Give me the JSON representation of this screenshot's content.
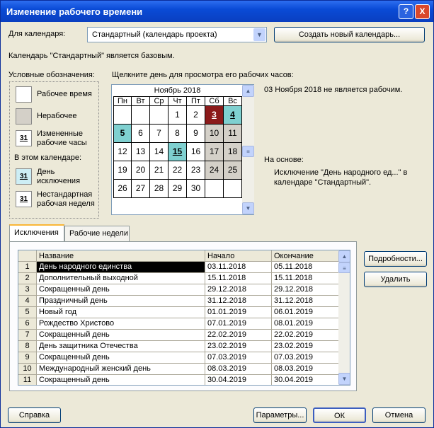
{
  "window": {
    "title": "Изменение рабочего времени",
    "help": "?",
    "close": "X"
  },
  "calendar_label": "Для календаря:",
  "calendar_value": "Стандартный (календарь проекта)",
  "create_button": "Создать новый календарь...",
  "base_note": "Календарь \"Стандартный\" является базовым.",
  "legend": {
    "title": "Условные обозначения:",
    "working": "Рабочее время",
    "nonworking": "Нерабочее",
    "changed": "Измененные рабочие часы",
    "changed_num": "31",
    "in_calendar": "В этом календаре:",
    "exception": "День исключения",
    "exception_num": "31",
    "nonstandard": "Нестандартная рабочая неделя",
    "nonstandard_num": "31"
  },
  "click_hint": "Щелкните день для просмотра его рабочих часов:",
  "calendar": {
    "month": "Ноябрь 2018",
    "weekdays": [
      "Пн",
      "Вт",
      "Ср",
      "Чт",
      "Пт",
      "Сб",
      "Вс"
    ],
    "rows": [
      [
        "",
        "",
        "",
        "1",
        "2",
        "3",
        "4"
      ],
      [
        "5",
        "6",
        "7",
        "8",
        "9",
        "10",
        "11"
      ],
      [
        "12",
        "13",
        "14",
        "15",
        "16",
        "17",
        "18"
      ],
      [
        "19",
        "20",
        "21",
        "22",
        "23",
        "24",
        "25"
      ],
      [
        "26",
        "27",
        "28",
        "29",
        "30",
        "",
        ""
      ]
    ]
  },
  "day_info": "03 Ноября 2018 не является рабочим.",
  "based_on_label": "На основе:",
  "based_on_text": "Исключение \"День народного ед...\" в календаре \"Стандартный\".",
  "tabs": [
    "Исключения",
    "Рабочие недели"
  ],
  "table": {
    "headers": [
      "Название",
      "Начало",
      "Окончание"
    ],
    "rows": [
      {
        "n": "1",
        "name": "День народного единства",
        "start": "03.11.2018",
        "end": "05.11.2018"
      },
      {
        "n": "2",
        "name": "Дополнительный выходной",
        "start": "15.11.2018",
        "end": "15.11.2018"
      },
      {
        "n": "3",
        "name": "Сокращенный день",
        "start": "29.12.2018",
        "end": "29.12.2018"
      },
      {
        "n": "4",
        "name": "Праздничный день",
        "start": "31.12.2018",
        "end": "31.12.2018"
      },
      {
        "n": "5",
        "name": "Новый год",
        "start": "01.01.2019",
        "end": "06.01.2019"
      },
      {
        "n": "6",
        "name": "Рождество Христово",
        "start": "07.01.2019",
        "end": "08.01.2019"
      },
      {
        "n": "7",
        "name": "Сокращенный день",
        "start": "22.02.2019",
        "end": "22.02.2019"
      },
      {
        "n": "8",
        "name": "День защитника Отечества",
        "start": "23.02.2019",
        "end": "23.02.2019"
      },
      {
        "n": "9",
        "name": "Сокращенный день",
        "start": "07.03.2019",
        "end": "07.03.2019"
      },
      {
        "n": "10",
        "name": "Международный женский день",
        "start": "08.03.2019",
        "end": "08.03.2019"
      },
      {
        "n": "11",
        "name": "Сокращенный день",
        "start": "30.04.2019",
        "end": "30.04.2019"
      }
    ]
  },
  "details_button": "Подробности...",
  "delete_button": "Удалить",
  "help_button": "Справка",
  "options_button": "Параметры...",
  "ok_button": "ОК",
  "cancel_button": "Отмена"
}
